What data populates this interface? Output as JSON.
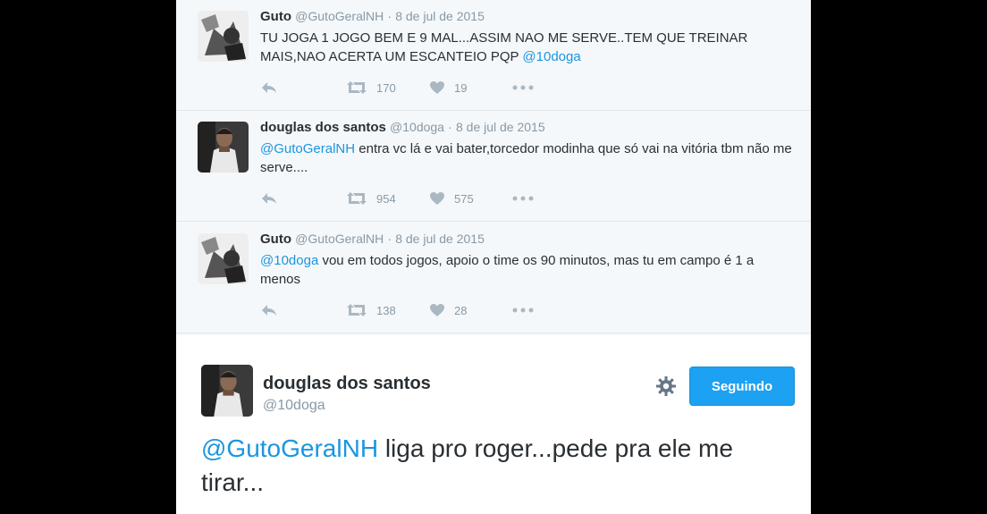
{
  "thread": [
    {
      "name": "Guto",
      "handle": "@GutoGeralNH",
      "sep": "·",
      "date": "8 de jul de 2015",
      "text": "TU JOGA 1 JOGO BEM E 9 MAL...ASSIM NAO ME SERVE..TEM QUE TREINAR MAIS,NAO ACERTA UM ESCANTEIO PQP ",
      "mention": "@10doga",
      "retweets": "170",
      "likes": "19",
      "avatar_icon": "user-avatar-icon"
    },
    {
      "name": "douglas dos santos",
      "handle": "@10doga",
      "sep": "·",
      "date": "8 de jul de 2015",
      "mention": "@GutoGeralNH",
      "text": " entra vc lá e vai bater,torcedor modinha  que só vai na vitória tbm não me serve....",
      "retweets": "954",
      "likes": "575",
      "avatar_icon": "user-avatar-icon"
    },
    {
      "name": "Guto",
      "handle": "@GutoGeralNH",
      "sep": "·",
      "date": "8 de jul de 2015",
      "mention": "@10doga",
      "text": " vou em todos jogos, apoio o time os 90 minutos, mas tu em campo é 1 a menos",
      "retweets": "138",
      "likes": "28",
      "avatar_icon": "user-avatar-icon"
    }
  ],
  "main": {
    "name": "douglas dos santos",
    "handle": "@10doga",
    "follow_label": "Seguindo",
    "mention": "@GutoGeralNH",
    "text": " liga pro roger...pede pra ele me tirar..."
  },
  "colors": {
    "accent": "#1da1f2",
    "mention": "#1b95e0",
    "thread_bg": "#f5f8fa"
  }
}
